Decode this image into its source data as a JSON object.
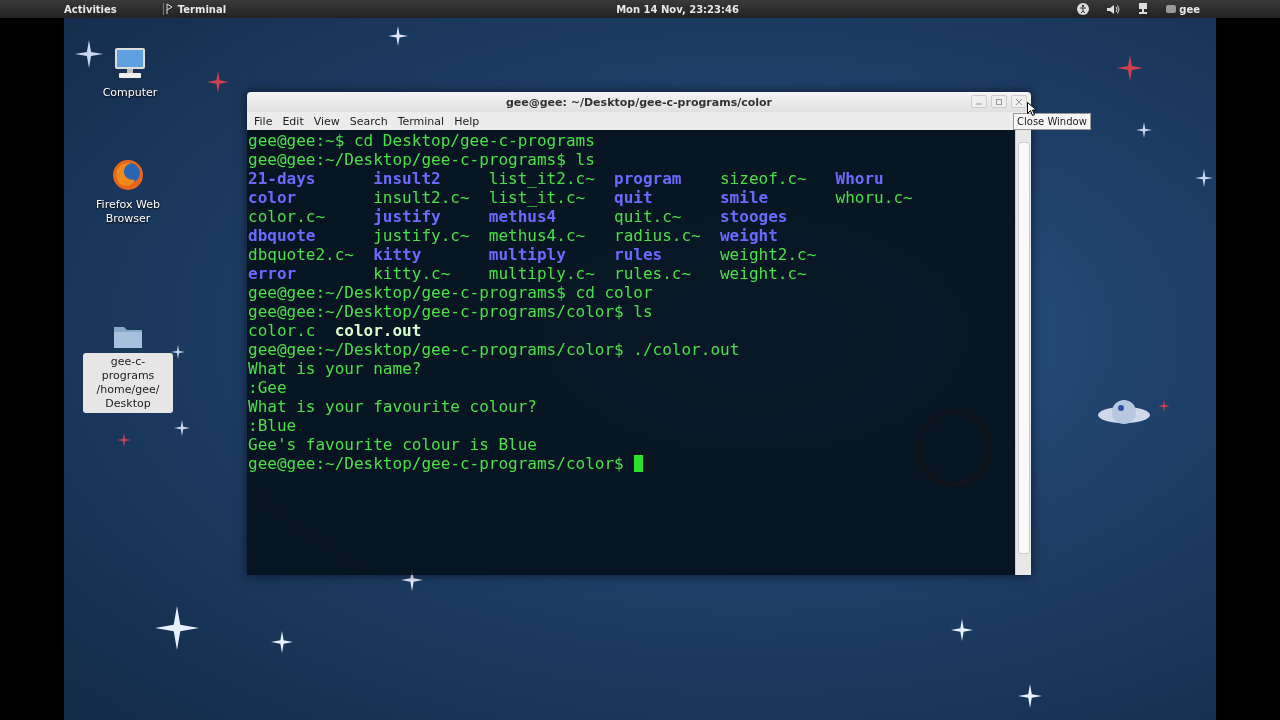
{
  "top_bar": {
    "activities": "Activities",
    "app_name": "Terminal",
    "clock": "Mon 14 Nov, 23:23:46",
    "user": "gee"
  },
  "desktop_icons": [
    {
      "kind": "computer",
      "label": "Computer",
      "selected": false
    },
    {
      "kind": "browser",
      "label": "Firefox Web Browser",
      "selected": false
    },
    {
      "kind": "folder",
      "label": "gee-c-programs /home/gee/ Desktop",
      "selected": true
    }
  ],
  "window": {
    "title": "gee@gee: ~/Desktop/gee-c-programs/color",
    "menu": [
      "File",
      "Edit",
      "View",
      "Search",
      "Terminal",
      "Help"
    ],
    "tooltip": "Close Window"
  },
  "terminal": {
    "lines": [
      {
        "kind": "text",
        "text": "gee@gee:~$ cd Desktop/gee-c-programs"
      },
      {
        "kind": "text",
        "text": "gee@gee:~/Desktop/gee-c-programs$ ls"
      },
      {
        "kind": "listing",
        "rows": [
          [
            {
              "name": "21-days",
              "kind": "directory"
            },
            {
              "name": "insult2",
              "kind": "directory"
            },
            {
              "name": "list_it2.c~",
              "kind": "file"
            },
            {
              "name": "program",
              "kind": "directory"
            },
            {
              "name": "sizeof.c~",
              "kind": "file"
            },
            {
              "name": "Whoru",
              "kind": "directory"
            }
          ],
          [
            {
              "name": "color",
              "kind": "directory"
            },
            {
              "name": "insult2.c~",
              "kind": "file"
            },
            {
              "name": "list_it.c~",
              "kind": "file"
            },
            {
              "name": "quit",
              "kind": "directory"
            },
            {
              "name": "smile",
              "kind": "directory"
            },
            {
              "name": "whoru.c~",
              "kind": "file"
            }
          ],
          [
            {
              "name": "color.c~",
              "kind": "file"
            },
            {
              "name": "justify",
              "kind": "directory"
            },
            {
              "name": "methus4",
              "kind": "directory"
            },
            {
              "name": "quit.c~",
              "kind": "file"
            },
            {
              "name": "stooges",
              "kind": "directory"
            }
          ],
          [
            {
              "name": "dbquote",
              "kind": "directory"
            },
            {
              "name": "justify.c~",
              "kind": "file"
            },
            {
              "name": "methus4.c~",
              "kind": "file"
            },
            {
              "name": "radius.c~",
              "kind": "file"
            },
            {
              "name": "weight",
              "kind": "directory"
            }
          ],
          [
            {
              "name": "dbquote2.c~",
              "kind": "file"
            },
            {
              "name": "kitty",
              "kind": "directory"
            },
            {
              "name": "multiply",
              "kind": "directory"
            },
            {
              "name": "rules",
              "kind": "directory"
            },
            {
              "name": "weight2.c~",
              "kind": "file"
            }
          ],
          [
            {
              "name": "error",
              "kind": "directory"
            },
            {
              "name": "kitty.c~",
              "kind": "file"
            },
            {
              "name": "multiply.c~",
              "kind": "file"
            },
            {
              "name": "rules.c~",
              "kind": "file"
            },
            {
              "name": "weight.c~",
              "kind": "file"
            }
          ]
        ]
      },
      {
        "kind": "text",
        "text": "gee@gee:~/Desktop/gee-c-programs$ cd color"
      },
      {
        "kind": "text",
        "text": "gee@gee:~/Desktop/gee-c-programs/color$ ls"
      },
      {
        "kind": "listing",
        "rows": [
          [
            {
              "name": "color.c",
              "kind": "file"
            },
            {
              "name": "color.out",
              "kind": "executable"
            }
          ]
        ]
      },
      {
        "kind": "text",
        "text": "gee@gee:~/Desktop/gee-c-programs/color$ ./color.out"
      },
      {
        "kind": "text",
        "text": "What is your name?"
      },
      {
        "kind": "text",
        "text": ":Gee"
      },
      {
        "kind": "text",
        "text": "What is your favourite colour?"
      },
      {
        "kind": "text",
        "text": ":Blue"
      },
      {
        "kind": "text",
        "text": "Gee's favourite colour is Blue"
      },
      {
        "kind": "prompt",
        "text": "gee@gee:~/Desktop/gee-c-programs/color$"
      }
    ]
  }
}
